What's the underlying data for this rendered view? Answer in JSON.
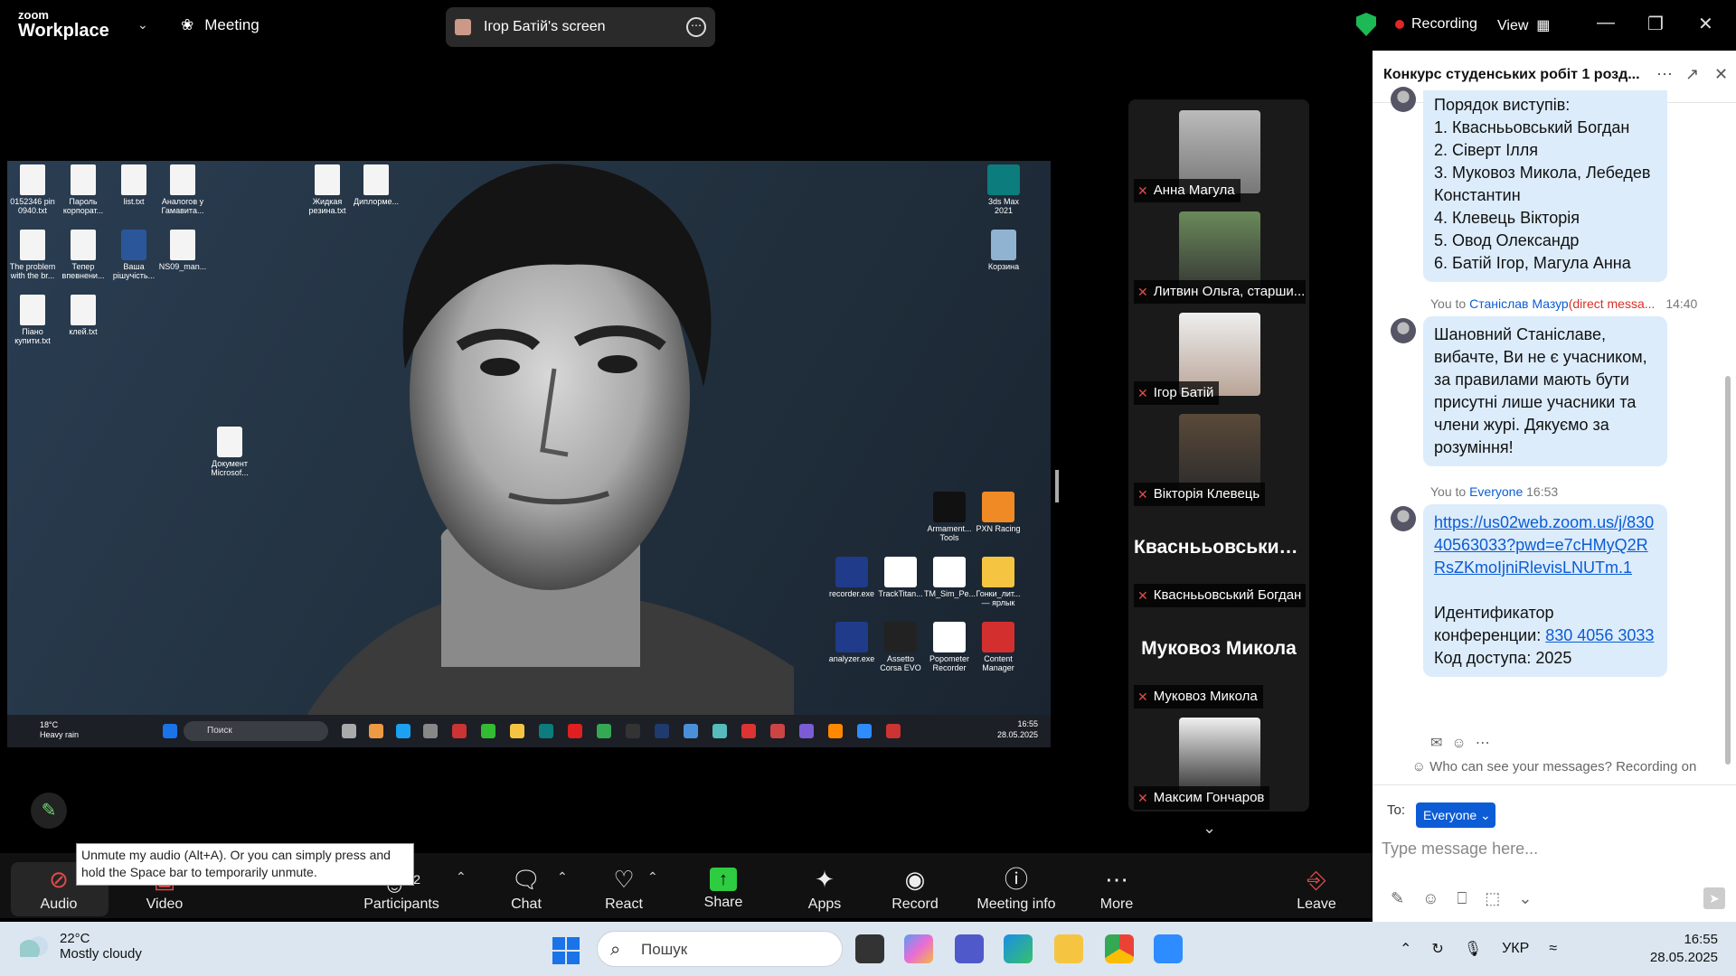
{
  "titlebar": {
    "logo_top": "zoom",
    "logo_bottom": "Workplace",
    "meeting_label": "Meeting",
    "screen_pill": "Ігор Батій's screen",
    "recording_label": "Recording",
    "view_label": "View"
  },
  "desktop": {
    "icons": [
      "0152346 pin 0940.txt",
      "Пароль корпорат...",
      "list.txt",
      "Аналогов у Гамавита...",
      "Жидкая резина.txt",
      "Диплорме...",
      "3ds Max 2021",
      "The problem with the br...",
      "Тепер впевнени...",
      "Ваша рішучість...",
      "NS09_man...",
      "Корзина",
      "Піано купити.txt",
      "клей.txt",
      "Документ Microsof...",
      "Armament... Tools",
      "PXN Racing",
      "recorder.exe",
      "TrackTitan...",
      "TM_Sim_Pe...",
      "Гонки_лит... — ярлык",
      "analyzer.exe",
      "Assetto Corsa EVO",
      "Popometer Recorder",
      "Content Manager"
    ],
    "weather_temp": "18°C",
    "weather_desc": "Heavy rain",
    "search_label": "Поиск",
    "time": "16:55",
    "date": "28.05.2025"
  },
  "participants": [
    {
      "name": "Анна Магула",
      "type": "photo"
    },
    {
      "name": "Литвин Ольга, старши...",
      "type": "photo"
    },
    {
      "name": "Ігор Батій",
      "type": "photo"
    },
    {
      "name": "Вікторія Клевець",
      "type": "photo"
    },
    {
      "name": "Кваснььовський Богдан",
      "big": "Кваснььовський...",
      "type": "text"
    },
    {
      "name": "Муковоз Микола",
      "big": "Муковоз Микола",
      "type": "text"
    },
    {
      "name": "Максим Гончаров",
      "type": "photo"
    }
  ],
  "tooltip": "Unmute my audio (Alt+A). Or you can simply press and hold the Space bar to temporarily unmute.",
  "toolbar": {
    "audio": "Audio",
    "video": "Video",
    "participants": "Participants",
    "participants_count": "22",
    "chat": "Chat",
    "react": "React",
    "share": "Share",
    "apps": "Apps",
    "record": "Record",
    "meeting_info": "Meeting info",
    "more": "More",
    "leave": "Leave"
  },
  "chat": {
    "title": "Конкурс студенських робіт 1 розд...",
    "message1_lines": [
      "Порядок виступів:",
      "1. Кваснььовський Богдан",
      "2. Сіверт Ілля",
      "3. Муковоз Микола, Лебедев Константин",
      "4. Клевець Вікторія",
      "5. Овод Олександр",
      "6. Батій Ігор, Магула Анна"
    ],
    "msg2_from": "You to",
    "msg2_to": "Станіслав Мазур",
    "msg2_dm": "(direct messa...",
    "msg2_time": "14:40",
    "message2": "Шановний Станіславе, вибачте, Ви не є учасником, за правилами мають бути присутні лише учасники та члени журі. Дякуємо за розуміння!",
    "msg3_from": "You to",
    "msg3_to": "Everyone",
    "msg3_time": "16:53",
    "message3_link": "https://us02web.zoom.us/j/83040563033?pwd=e7cHMyQ2RRsZKmoIjniRlevisLNUTm.1",
    "message3_id_label": "Идентификатор конференции:",
    "message3_id": "830 4056 3033",
    "message3_code": "Код доступа: 2025",
    "who_can_see": "Who can see your messages? Recording on",
    "to_label": "To:",
    "to_value": "Everyone",
    "input_placeholder": "Type message here..."
  },
  "taskbar": {
    "temp": "22°C",
    "weather": "Mostly cloudy",
    "search_placeholder": "Пошук",
    "lang": "УКР",
    "time": "16:55",
    "date": "28.05.2025"
  }
}
